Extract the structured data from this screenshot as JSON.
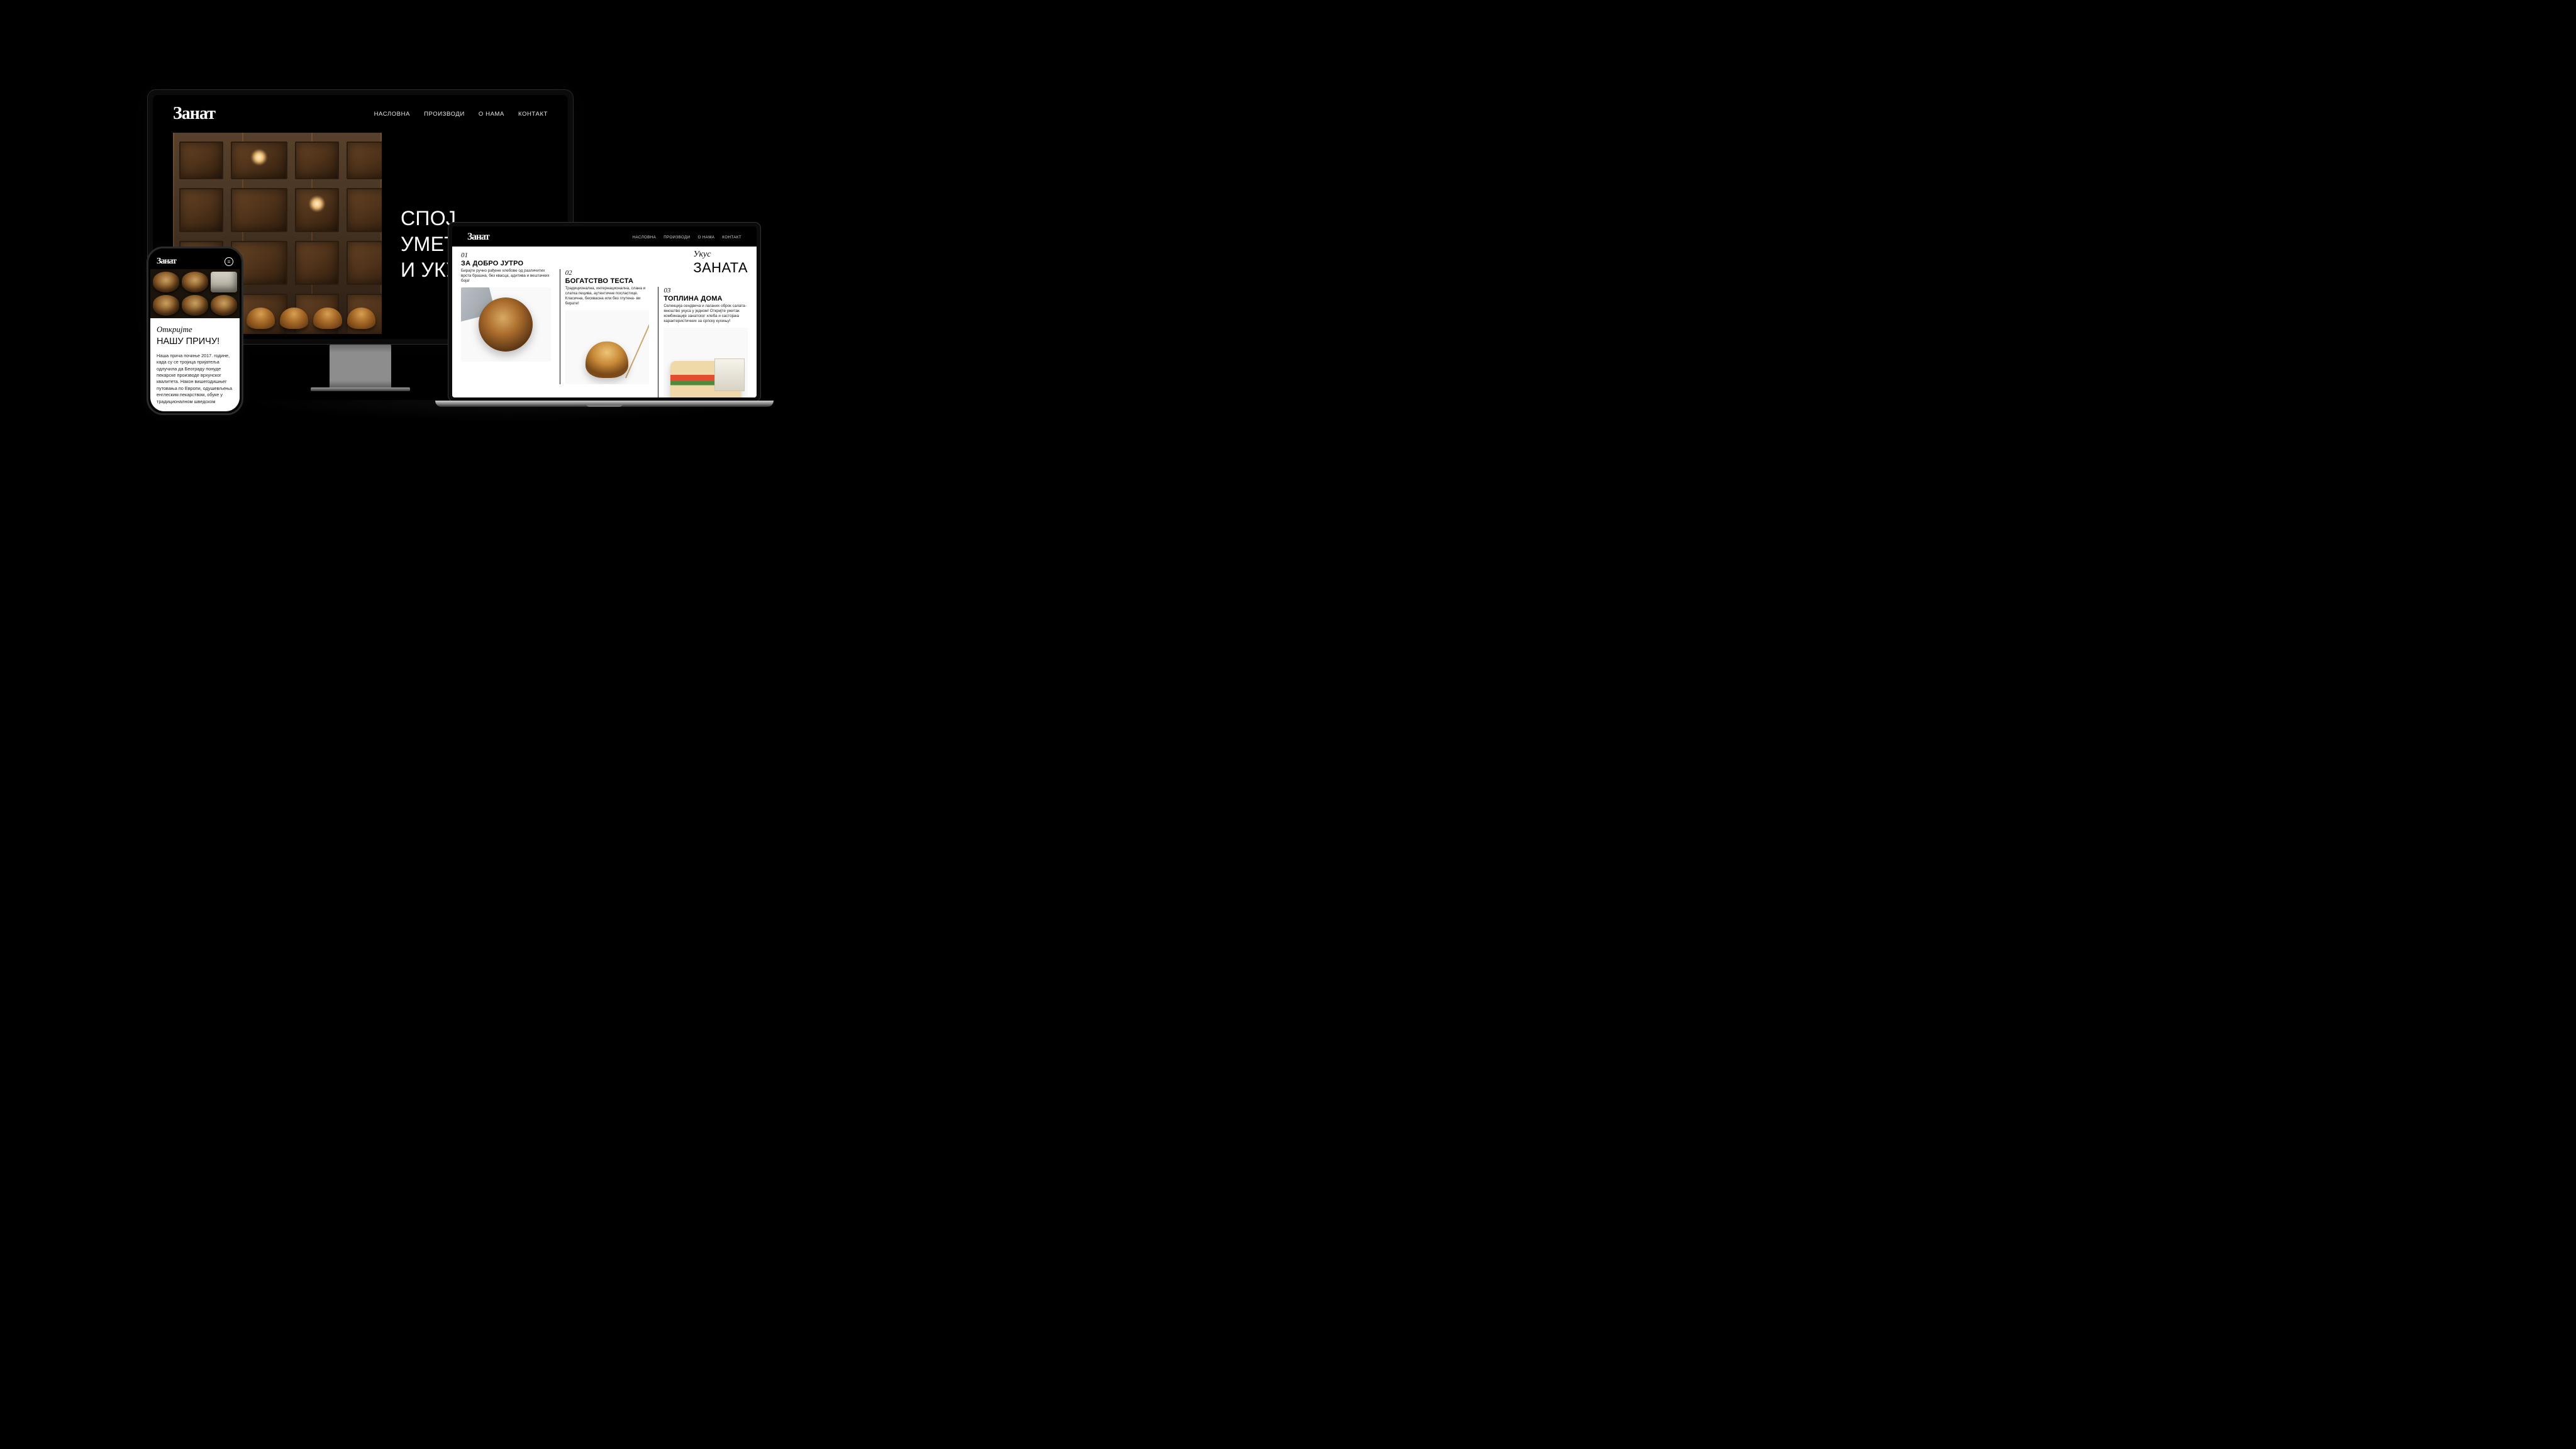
{
  "brand": "Занат",
  "nav": {
    "home": "НАСЛОВНА",
    "products": "ПРОИЗВОДИ",
    "about": "О НАМА",
    "contact": "КОНТАКТ"
  },
  "desktop": {
    "hero_line1": "СПОЈ",
    "hero_line2": "УМЕТНОСТИ",
    "hero_line3": "И УКУСА"
  },
  "phone": {
    "italic": "Откријте",
    "headline": "НАШУ ПРИЧУ!",
    "body": "Наша прича почиње 2017. године, када су се тројица пријатеља одлучила да Београду понуде пекарске производе врхунског квалитета. Након вишегодишњег путовања по Европи, одушевљења енглеским пекарством, обуке у традиционалном шведском"
  },
  "laptop": {
    "section_italic": "Укус",
    "section_big": "ЗАНАТА",
    "products": [
      {
        "num": "01",
        "title": "ЗА ДОБРО ЈУТРО",
        "desc": "Бирајте ручно рађене хлебове од различитих врста брашна, без квасца, адитива и вештачких боја!"
      },
      {
        "num": "02",
        "title": "БОГАТСТВО ТЕСТА",
        "desc": "Традиционална, интернационална, слана и слатка пецива, аутентичне посластице. Класична, бесквасна или без глутена- ви бирате!"
      },
      {
        "num": "03",
        "title": "ТОПЛИНА ДОМА",
        "desc": "Селекција сендвича и лаганих оброк салата- мноштво укуса у једном! Откријте ужитак комбинације занатског хлеба и састојака карактеристичних за српску кухињу!"
      }
    ]
  }
}
